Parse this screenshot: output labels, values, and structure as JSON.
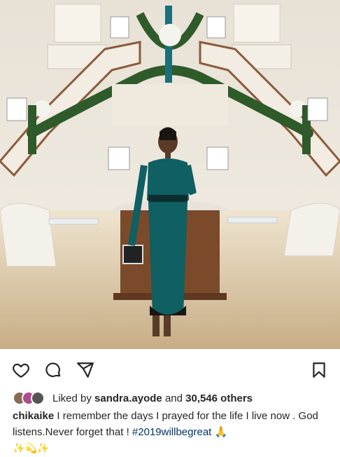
{
  "post": {
    "photo_name": "post-photo",
    "likes": {
      "prefix": "Liked by",
      "user": "sandra.ayode",
      "joiner": "and",
      "count_text": "30,546 others"
    },
    "caption": {
      "username": "chikaike",
      "text": "I remember the days I prayed for the life I live now . God listens.Never forget that !",
      "hashtag": "#2019willbegreat",
      "emoji_praying": "🙏",
      "emoji_sparkles": "✨",
      "emoji_face": "💫"
    }
  },
  "icons": [
    "heart-icon",
    "comment-icon",
    "share-icon",
    "bookmark-icon"
  ],
  "colors": {
    "hashtag": "#003569",
    "text": "#262626",
    "dress": "#0f5f63"
  }
}
